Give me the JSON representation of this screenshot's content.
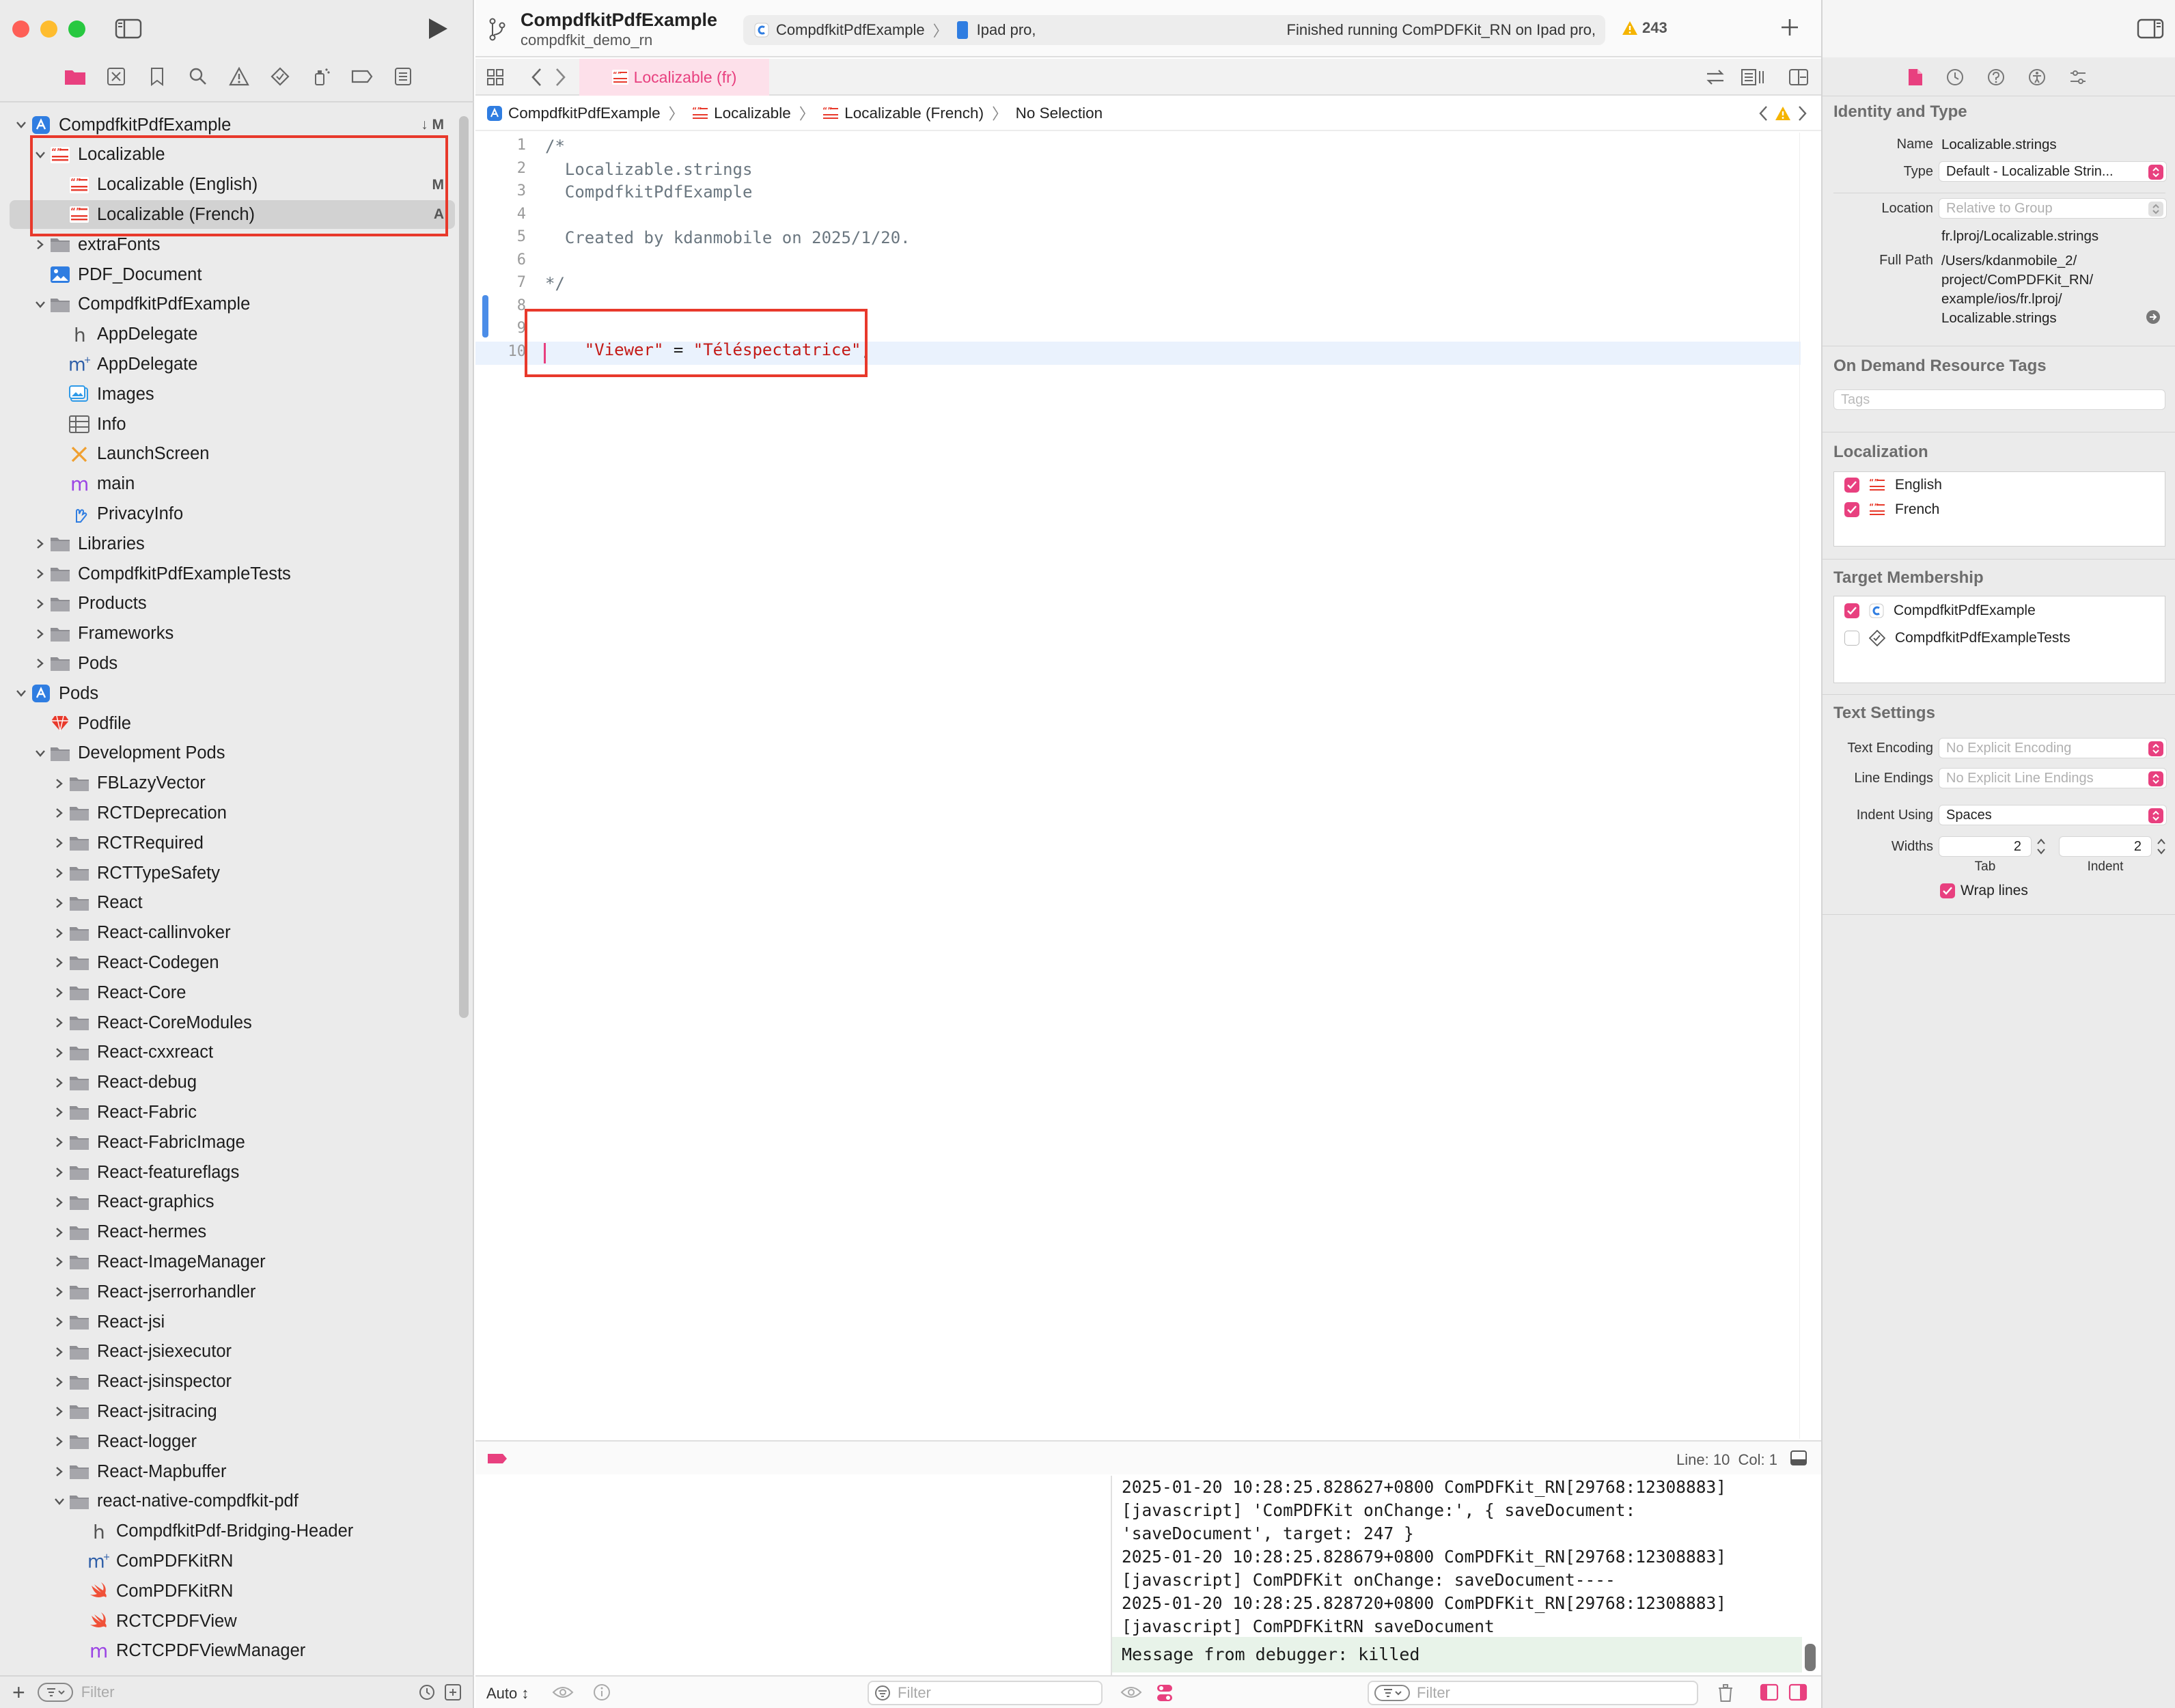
{
  "toolbar": {
    "project_title": "CompdfkitPdfExample",
    "project_subtitle": "compdfkit_demo_rn",
    "scheme_name": "CompdfkitPdfExample",
    "device_name": "Ipad pro,",
    "status_message": "Finished running ComPDFKit_RN on Ipad pro,",
    "warning_count": "243"
  },
  "navigator": {
    "root_project": {
      "label": "CompdfkitPdfExample",
      "badge": "↓ M"
    },
    "items": [
      {
        "label": "Localizable",
        "badge": ""
      },
      {
        "label": "Localizable (English)",
        "badge": "M"
      },
      {
        "label": "Localizable (French)",
        "badge": "A"
      },
      {
        "label": "extraFonts",
        "badge": ""
      },
      {
        "label": "PDF_Document",
        "badge": ""
      },
      {
        "label": "CompdfkitPdfExample",
        "badge": ""
      },
      {
        "label": "AppDelegate",
        "badge": ""
      },
      {
        "label": "AppDelegate",
        "badge": ""
      },
      {
        "label": "Images",
        "badge": ""
      },
      {
        "label": "Info",
        "badge": ""
      },
      {
        "label": "LaunchScreen",
        "badge": ""
      },
      {
        "label": "main",
        "badge": ""
      },
      {
        "label": "PrivacyInfo",
        "badge": ""
      },
      {
        "label": "Libraries",
        "badge": ""
      },
      {
        "label": "CompdfkitPdfExampleTests",
        "badge": ""
      },
      {
        "label": "Products",
        "badge": ""
      },
      {
        "label": "Frameworks",
        "badge": ""
      },
      {
        "label": "Pods",
        "badge": ""
      }
    ],
    "pods_project": {
      "label": "Pods"
    },
    "pods_items": [
      "Podfile",
      "Development Pods",
      "FBLazyVector",
      "RCTDeprecation",
      "RCTRequired",
      "RCTTypeSafety",
      "React",
      "React-callinvoker",
      "React-Codegen",
      "React-Core",
      "React-CoreModules",
      "React-cxxreact",
      "React-debug",
      "React-Fabric",
      "React-FabricImage",
      "React-featureflags",
      "React-graphics",
      "React-hermes",
      "React-ImageManager",
      "React-jserrorhandler",
      "React-jsi",
      "React-jsiexecutor",
      "React-jsinspector",
      "React-jsitracing",
      "React-logger",
      "React-Mapbuffer",
      "react-native-compdfkit-pdf",
      "CompdfkitPdf-Bridging-Header",
      "ComPDFKitRN",
      "ComPDFKitRN",
      "RCTCPDFView",
      "RCTCPDFViewManager"
    ],
    "filter_placeholder": "Filter"
  },
  "editor": {
    "tab_label": "Localizable (fr)",
    "breadcrumb": [
      "CompdfkitPdfExample",
      "Localizable",
      "Localizable (French)",
      "No Selection"
    ],
    "lines": [
      {
        "n": "1",
        "text": "/*"
      },
      {
        "n": "2",
        "text": "  Localizable.strings"
      },
      {
        "n": "3",
        "text": "  CompdfkitPdfExample"
      },
      {
        "n": "4",
        "text": ""
      },
      {
        "n": "5",
        "text": "  Created by kdanmobile on 2025/1/20."
      },
      {
        "n": "6",
        "text": ""
      },
      {
        "n": "7",
        "text": "*/"
      },
      {
        "n": "8",
        "text": ""
      },
      {
        "n": "9",
        "text": ""
      },
      {
        "n": "10",
        "text": ""
      }
    ],
    "code_key": "\"Viewer\"",
    "code_eq": " = ",
    "code_value": "\"Téléspectatrice\"",
    "code_semicolon": ";",
    "status": "Line: 10  Col: 1"
  },
  "debug": {
    "auto_label": "Auto ↕",
    "filter_placeholder": "Filter",
    "console_lines": [
      "2025-01-20 10:28:25.828627+0800 ComPDFKit_RN[29768:12308883]",
      "[javascript] 'ComPDFKit onChange:', { saveDocument:",
      "'saveDocument', target: 247 }",
      "2025-01-20 10:28:25.828679+0800 ComPDFKit_RN[29768:12308883]",
      "[javascript] ComPDFKit onChange: saveDocument----",
      "2025-01-20 10:28:25.828720+0800 ComPDFKit_RN[29768:12308883]",
      "[javascript] ComPDFKitRN saveDocument"
    ],
    "killed_message": "Message from debugger: killed"
  },
  "inspector": {
    "identity_title": "Identity and Type",
    "name_label": "Name",
    "name_value": "Localizable.strings",
    "type_label": "Type",
    "type_value": "Default - Localizable Strin...",
    "location_label": "Location",
    "location_value": "Relative to Group",
    "location_path": "fr.lproj/Localizable.strings",
    "fullpath_label": "Full Path",
    "fullpath_lines": [
      "/Users/kdanmobile_2/",
      "project/ComPDFKit_RN/",
      "example/ios/fr.lproj/",
      "Localizable.strings"
    ],
    "odr_title": "On Demand Resource Tags",
    "tags_placeholder": "Tags",
    "localization_title": "Localization",
    "localizations": [
      "English",
      "French"
    ],
    "target_title": "Target Membership",
    "targets": [
      {
        "label": "CompdfkitPdfExample",
        "checked": true
      },
      {
        "label": "CompdfkitPdfExampleTests",
        "checked": false
      }
    ],
    "text_settings_title": "Text Settings",
    "encoding_label": "Text Encoding",
    "encoding_value": "No Explicit Encoding",
    "endings_label": "Line Endings",
    "endings_value": "No Explicit Line Endings",
    "indent_label": "Indent Using",
    "indent_value": "Spaces",
    "widths_label": "Widths",
    "tab_width": "2",
    "indent_width": "2",
    "tab_caption": "Tab",
    "indent_caption": "Indent",
    "wrap_label": "Wrap lines"
  },
  "colors": {
    "accent": "#e8407f",
    "highlight_red": "#e8392b",
    "folder": "#8e8e93",
    "string_red": "#c41a16"
  }
}
